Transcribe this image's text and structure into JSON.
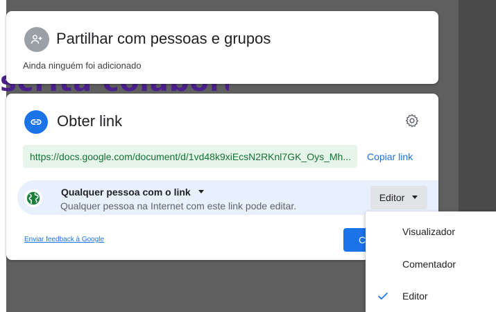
{
  "background": {
    "document_heading_fragment": "scrita colaborativa"
  },
  "share_card": {
    "title": "Partilhar com pessoas e grupos",
    "status": "Ainda ninguém foi adicionado"
  },
  "link_card": {
    "title": "Obter link",
    "url": "https://docs.google.com/document/d/1vd48k9xiEcsN2RKnl7GK_Oys_Mh...",
    "copy_link_label": "Copiar link",
    "access": {
      "title": "Qualquer pessoa com o link",
      "description": "Qualquer pessoa na Internet com este link pode editar.",
      "role_label": "Editor"
    },
    "feedback_label": "Enviar feedback à Google",
    "done_label_partial": "C"
  },
  "role_menu": {
    "items": [
      {
        "label": "Visualizador",
        "selected": false
      },
      {
        "label": "Comentador",
        "selected": false
      },
      {
        "label": "Editor",
        "selected": true
      }
    ]
  },
  "colors": {
    "accent": "#1a73e8",
    "url_text": "#137333",
    "url_bg": "#e6f4ea",
    "access_bg": "#e8f0fe",
    "globe": "#188038"
  },
  "icons": {
    "share": "person-add-icon",
    "link": "link-icon",
    "settings": "gear-icon",
    "access": "globe-icon",
    "dropdown": "caret-down-icon",
    "selected": "checkmark-icon"
  }
}
